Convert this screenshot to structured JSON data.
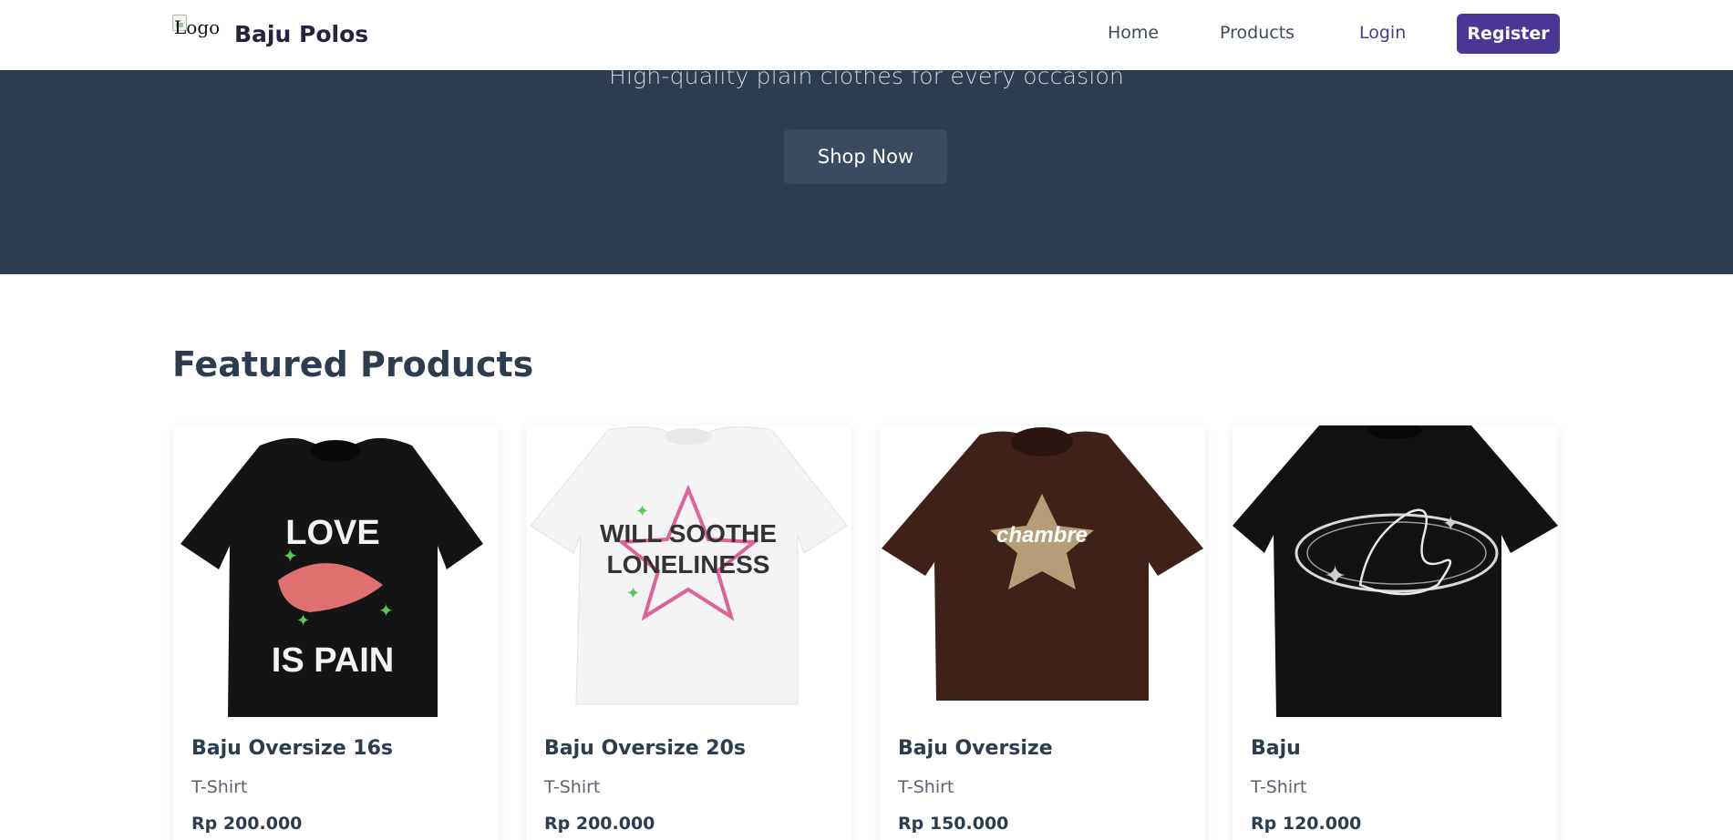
{
  "navbar": {
    "logo_alt": "Logo",
    "brand": "Baju Polos",
    "links": {
      "home": "Home",
      "products": "Products",
      "login": "Login"
    },
    "register": "Register",
    "accent": "#4a3697"
  },
  "hero": {
    "subtitle": "High-quality plain clothes for every occasion",
    "cta": "Shop Now",
    "background": "#2e3d50"
  },
  "featured": {
    "title": "Featured Products",
    "products": [
      {
        "name": "Baju Oversize 16s",
        "category": "T-Shirt",
        "price": "Rp 200.000",
        "shirt_color": "#141414",
        "print_lines": [
          "LOVE",
          "IS PAIN"
        ]
      },
      {
        "name": "Baju Oversize 20s",
        "category": "T-Shirt",
        "price": "Rp 200.000",
        "shirt_color": "#f4f4f4",
        "print_lines": [
          "WILL SOOTHE",
          "LONELINESS"
        ]
      },
      {
        "name": "Baju Oversize",
        "category": "T-Shirt",
        "price": "Rp 150.000",
        "shirt_color": "#3e2119",
        "print_lines": [
          "chambre"
        ]
      },
      {
        "name": "Baju",
        "category": "T-Shirt",
        "price": "Rp 120.000",
        "shirt_color": "#121212",
        "print_lines": []
      }
    ]
  }
}
